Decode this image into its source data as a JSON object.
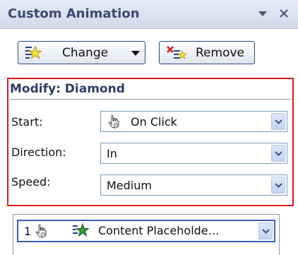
{
  "pane": {
    "title": "Custom Animation"
  },
  "toolbar": {
    "change_label": "Change",
    "remove_label": "Remove"
  },
  "modify": {
    "title": "Modify: Diamond",
    "start_label": "Start:",
    "start_value": "On Click",
    "direction_label": "Direction:",
    "direction_value": "In",
    "speed_label": "Speed:",
    "speed_value": "Medium"
  },
  "animation_list": {
    "items": [
      {
        "order": "1",
        "trigger_icon": "mouse-icon",
        "effect_icon": "star-icon",
        "label": "Content Placeholde…"
      }
    ]
  },
  "colors": {
    "highlight_border": "#e01818",
    "title_text": "#3a4a72",
    "selection_border": "#3b61b8"
  }
}
